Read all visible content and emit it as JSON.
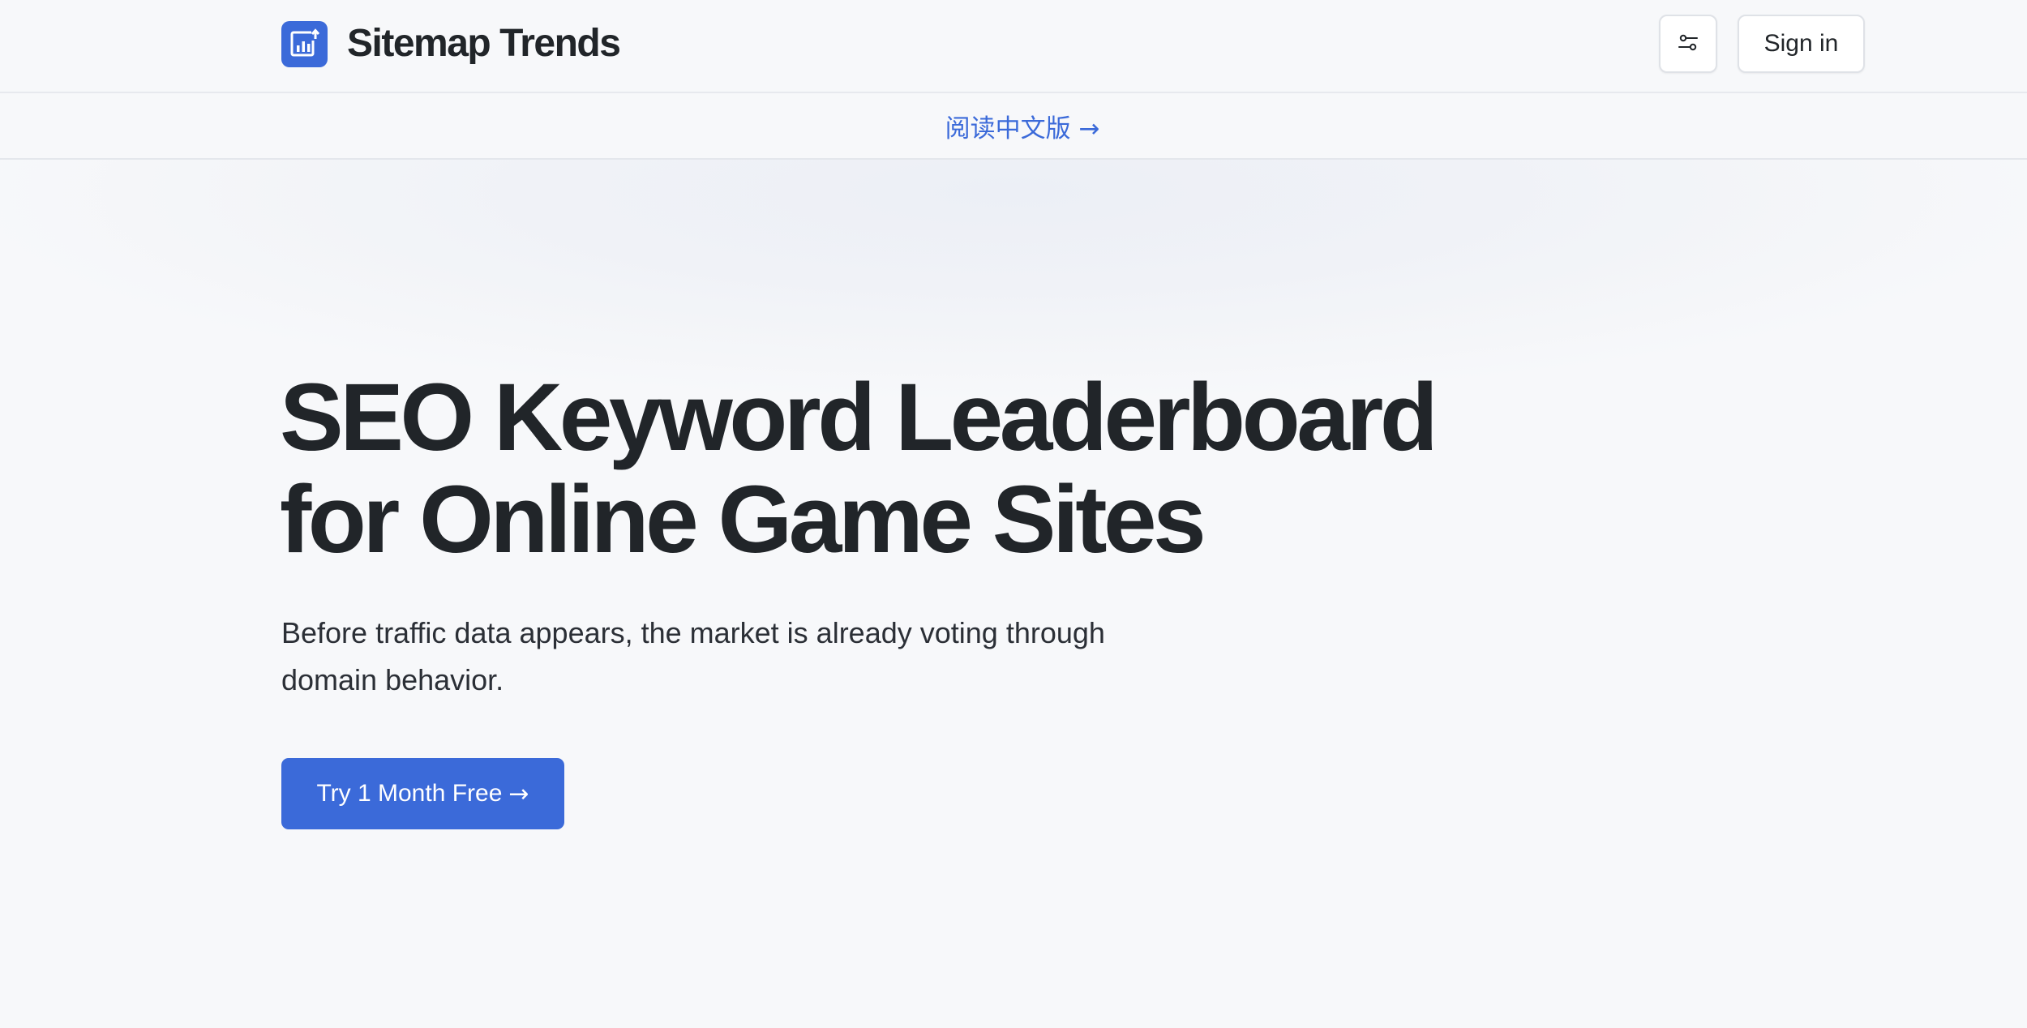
{
  "header": {
    "brand_name": "Sitemap Trends",
    "logo_icon": "bar-chart-trend-icon",
    "settings_icon": "sliders-icon",
    "signin_label": "Sign in"
  },
  "lang_banner": {
    "link_text": "阅读中文版 →"
  },
  "hero": {
    "title_line1": "SEO Keyword Leaderboard",
    "title_line2": "for Online Game Sites",
    "subtitle_line1": "Before traffic data appears, the market is already voting through",
    "subtitle_line2": "domain behavior.",
    "cta_label": "Try 1 Month Free",
    "cta_arrow": "→"
  },
  "colors": {
    "accent": "#3b6ad9",
    "text": "#212529",
    "background": "#f7f8fa"
  }
}
